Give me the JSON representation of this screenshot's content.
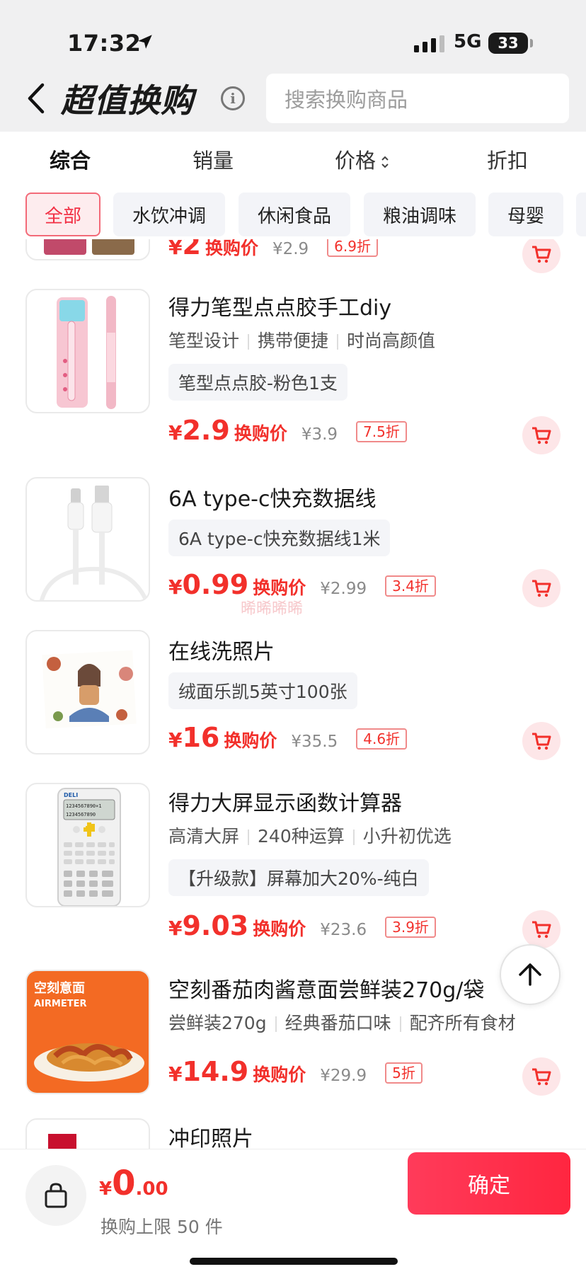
{
  "status_bar": {
    "time": "17:32",
    "network": "5G",
    "battery": "33"
  },
  "header": {
    "title": "超值换购",
    "search_placeholder": "搜索换购商品"
  },
  "sort_tabs": [
    "综合",
    "销量",
    "价格",
    "折扣"
  ],
  "categories": [
    "全部",
    "水饮冲调",
    "休闲食品",
    "粮油调味",
    "母婴"
  ],
  "partial_top_item": {
    "price": "2",
    "price_label": "换购价",
    "original": "¥2.9",
    "discount": "6.9折"
  },
  "products": [
    {
      "name": "得力笔型点点胶手工diy",
      "tags": [
        "笔型设计",
        "携带便捷",
        "时尚高颜值"
      ],
      "variant": "笔型点点胶-粉色1支",
      "price": "2.9",
      "price_label": "换购价",
      "original": "¥3.9",
      "discount": "7.5折"
    },
    {
      "name": "6A type-c快充数据线",
      "tags": [],
      "variant": "6A type-c快充数据线1米",
      "price": "0.99",
      "price_label": "换购价",
      "original": "¥2.99",
      "discount": "3.4折"
    },
    {
      "name": "在线洗照片",
      "tags": [],
      "variant": "绒面乐凯5英寸100张",
      "price": "16",
      "price_label": "换购价",
      "original": "¥35.5",
      "discount": "4.6折"
    },
    {
      "name": "得力大屏显示函数计算器",
      "tags": [
        "高清大屏",
        "240种运算",
        "小升初优选"
      ],
      "variant": "【升级款】屏幕加大20%-纯白",
      "price": "9.03",
      "price_label": "换购价",
      "original": "¥23.6",
      "discount": "3.9折"
    },
    {
      "name": "空刻番茄肉酱意面尝鲜装270g/袋",
      "tags": [
        "尝鲜装270g",
        "经典番茄口味",
        "配齐所有食材"
      ],
      "variant": "",
      "price": "14.9",
      "price_label": "换购价",
      "original": "¥29.9",
      "discount": "5折",
      "thumb_brand": "空刻意面",
      "thumb_brand_en": "AIRMETER"
    },
    {
      "name": "冲印照片"
    }
  ],
  "watermark": "晞晞晞晞",
  "thumb_texts": {
    "calculator_brand": "DELI",
    "calculator_display": "1234567890×1",
    "calculator_display2": "1234567890"
  },
  "bottom": {
    "currency": "¥",
    "total_int": "0",
    "total_dec": ".00",
    "limit": "换购上限 50 件",
    "confirm": "确定"
  },
  "colors": {
    "accent": "#f2302b",
    "confirm": "#ff2d4a",
    "chip_active_bg": "#fdecee"
  }
}
